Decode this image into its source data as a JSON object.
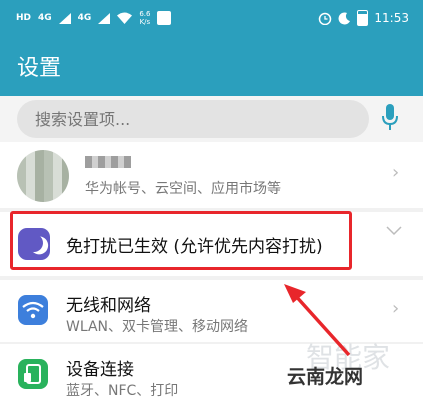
{
  "status_bar": {
    "tag1": "HD",
    "tag2": "4G",
    "tag3": "4G",
    "speed_value": "6.6",
    "speed_unit": "K/s",
    "time": "11:53"
  },
  "header": {
    "title": "设置"
  },
  "search": {
    "placeholder": "搜索设置项..."
  },
  "account": {
    "subtitle": "华为帐号、云空间、应用市场等"
  },
  "dnd": {
    "label": "免打扰已生效 (允许优先内容打扰)"
  },
  "wireless": {
    "title": "无线和网络",
    "subtitle": "WLAN、双卡管理、移动网络"
  },
  "connection": {
    "title": "设备连接",
    "subtitle": "蓝牙、NFC、打印"
  },
  "watermark": {
    "text": "云南龙网",
    "faded_text": "智能家"
  },
  "colors": {
    "header": "#2b9fbd",
    "dnd_icon": "#6159c4",
    "wifi_icon": "#3d7fdc",
    "connect_icon": "#29b25c",
    "highlight": "#e8262b"
  }
}
